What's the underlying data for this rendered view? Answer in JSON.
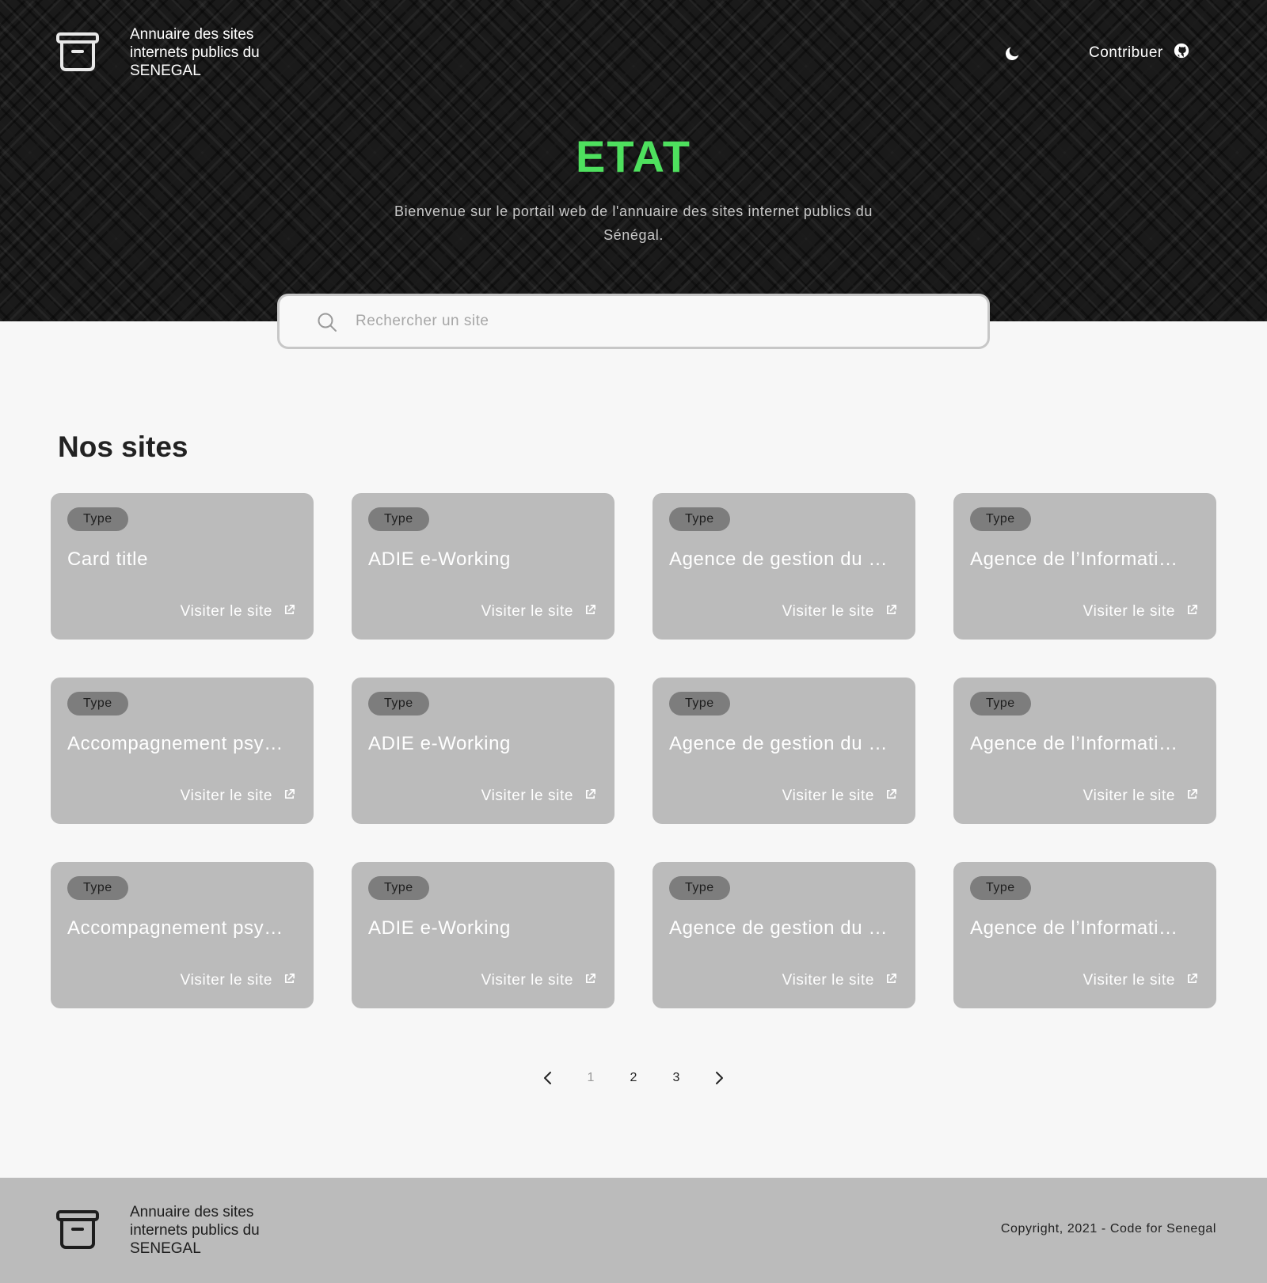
{
  "header": {
    "brand": "Annuaire des sites internets publics du SENEGAL",
    "contribute_label": "Contribuer"
  },
  "hero": {
    "title": "ETAT",
    "subtitle": "Bienvenue sur le portail web de l'annuaire des sites internet publics du Sénégal."
  },
  "search": {
    "placeholder": "Rechercher un site",
    "value": ""
  },
  "section": {
    "title": "Nos sites"
  },
  "cards": [
    {
      "type": "Type",
      "title": "Card title",
      "link": "Visiter le site"
    },
    {
      "type": "Type",
      "title": "ADIE e-Working",
      "link": "Visiter le site"
    },
    {
      "type": "Type",
      "title": "Agence de gestion du …",
      "link": "Visiter le site"
    },
    {
      "type": "Type",
      "title": "Agence de l’Informati…",
      "link": "Visiter le site"
    },
    {
      "type": "Type",
      "title": "Accompagnement psy…",
      "link": "Visiter le site"
    },
    {
      "type": "Type",
      "title": "ADIE e-Working",
      "link": "Visiter le site"
    },
    {
      "type": "Type",
      "title": "Agence de gestion du …",
      "link": "Visiter le site"
    },
    {
      "type": "Type",
      "title": "Agence de l’Informati…",
      "link": "Visiter le site"
    },
    {
      "type": "Type",
      "title": "Accompagnement psy…",
      "link": "Visiter le site"
    },
    {
      "type": "Type",
      "title": "ADIE e-Working",
      "link": "Visiter le site"
    },
    {
      "type": "Type",
      "title": "Agence de gestion du …",
      "link": "Visiter le site"
    },
    {
      "type": "Type",
      "title": "Agence de l’Informati…",
      "link": "Visiter le site"
    }
  ],
  "pagination": {
    "pages": [
      "1",
      "2",
      "3"
    ],
    "current": "1"
  },
  "footer": {
    "brand": "Annuaire des sites internets publics du SENEGAL",
    "copyright": "Copyright, 2021 - Code for Senegal"
  },
  "colors": {
    "accent": "#4ee05e",
    "card": "#bbbbbb",
    "badge": "#7d7d7d",
    "hero_bg": "#1a1a1a"
  },
  "icons": {
    "logo": "archive-box-icon",
    "theme": "moon-icon",
    "contribute": "github-icon",
    "search": "search-icon",
    "visit": "external-link-icon",
    "prev": "chevron-left-icon",
    "next": "chevron-right-icon"
  }
}
